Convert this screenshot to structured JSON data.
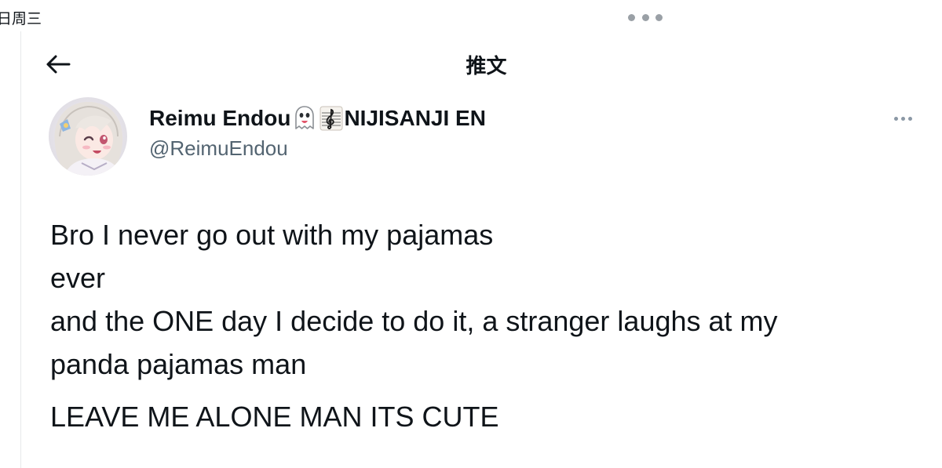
{
  "status_bar": {
    "date_fragment": "日周三"
  },
  "header": {
    "title": "推文"
  },
  "author": {
    "display_name": "Reimu Endou",
    "display_name_suffix": "NIJISANJI EN",
    "handle": "@ReimuEndou",
    "name_icons": [
      "ghost-icon",
      "treble-clef-icon"
    ]
  },
  "tweet": {
    "lines": [
      "Bro I never go out with my pajamas",
      "ever",
      "and the ONE day I decide to do it, a stranger laughs at my",
      "panda pajamas man",
      "LEAVE ME ALONE MAN ITS CUTE"
    ]
  },
  "colors": {
    "text_primary": "#0f1419",
    "text_secondary": "#536471",
    "divider": "#e7e9ea"
  }
}
